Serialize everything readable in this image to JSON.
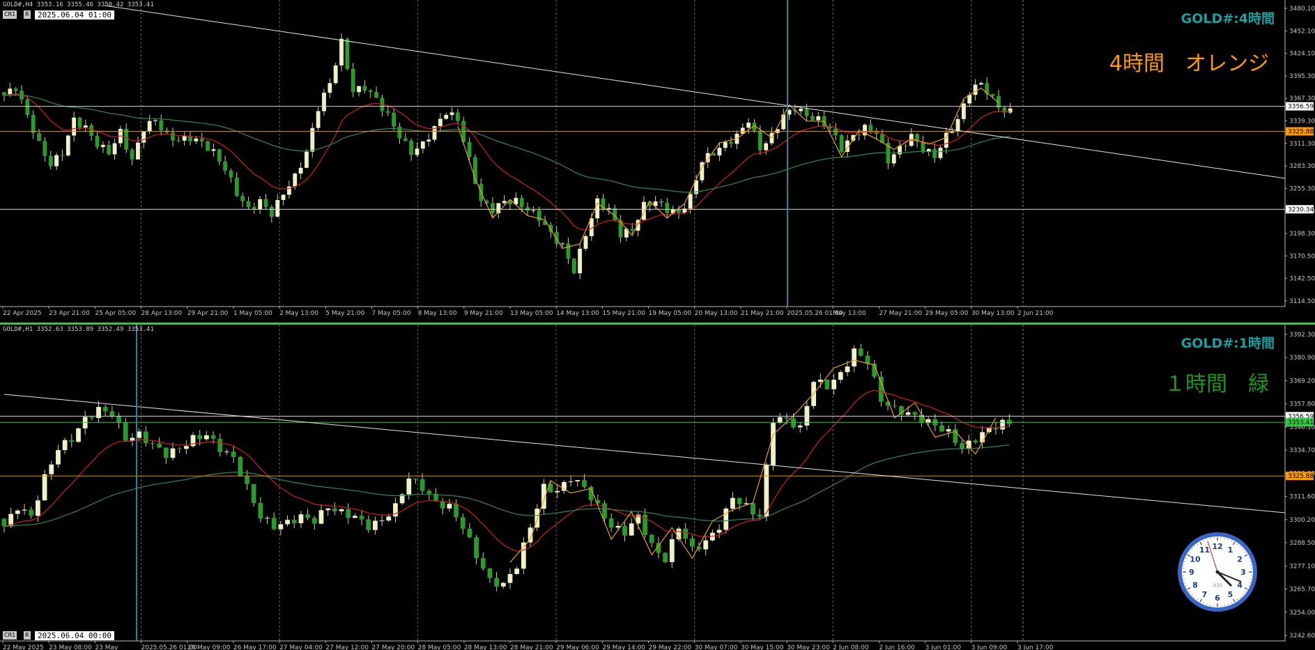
{
  "top": {
    "header": "GOLD#,H4  3353.16 3355.46 3350.42 3353.41",
    "cr_label": "CR1",
    "r_label": "R",
    "date_box": "2025.06.04 01:00",
    "title": "GOLD#:4時間",
    "subtitle": "4時間　オレンジ",
    "subtitle_color": "#ff9900",
    "x_labels": [
      "22 Apr 2025",
      "23 Apr 21:00",
      "25 Apr 05:00",
      "28 Apr 13:00",
      "29 Apr 21:00",
      "1 May 05:00",
      "2 May 13:00",
      "5 May 21:00",
      "7 May 05:00",
      "8 May 13:00",
      "9 May 21:00",
      "13 May 05:00",
      "14 May 13:00",
      "15 May 21:00",
      "19 May 05:00",
      "20 May 13:00",
      "21 May 21:00",
      "2025.05.26 01:00",
      "May 13:00",
      "27 May 21:00",
      "29 May 05:00",
      "30 May 13:00",
      "2 Jun 21:00"
    ],
    "y_labels": [
      "3480.10",
      "3452.10",
      "3424.10",
      "3395.30",
      "3367.30",
      "3339.30",
      "3311.30",
      "3283.30",
      "3255.30",
      "3226.30",
      "3198.30",
      "3170.50",
      "3142.50",
      "3114.50"
    ],
    "price_tags": [
      "3356.59",
      "3325.88",
      "3230.34"
    ]
  },
  "bottom": {
    "header": "GOLD#,H1  3352.63 3353.89 3352.49 3353.41",
    "cr_label": "CR1",
    "r_label": "R",
    "date_box": "2025.06.04 00:00",
    "title": "GOLD#:1時間",
    "subtitle": "１時間　緑",
    "subtitle_color": "#1a9a1a",
    "x_labels": [
      "22 May 2025",
      "23 May 08:00",
      "23 May",
      "2025.05.26 01:00",
      "26 May 09:00",
      "26 May 17:00",
      "27 May 04:00",
      "27 May 12:00",
      "27 May 20:00",
      "28 May 05:00",
      "28 May 13:00",
      "28 May 21:00",
      "29 May 06:00",
      "29 May 14:00",
      "29 May 22:00",
      "30 May 07:00",
      "30 May 15:00",
      "30 May 23:00",
      "2 Jun 08:00",
      "2 Jun 16:00",
      "3 Jun 01:00",
      "3 Jun 09:00",
      "3 Jun 17:00"
    ],
    "y_labels": [
      "3392.30",
      "3380.90",
      "3369.20",
      "3357.80",
      "3346.10",
      "3334.70",
      "3323.30",
      "3311.60",
      "3300.20",
      "3288.50",
      "3277.10",
      "3265.70",
      "3254.00",
      "3242.60"
    ],
    "price_tags": [
      "3356.59",
      "3353.41",
      "3325.88"
    ]
  },
  "clock": {
    "numbers": [
      "12",
      "1",
      "2",
      "3",
      "4",
      "5",
      "6",
      "7",
      "8",
      "9",
      "10",
      "11"
    ],
    "am_label": "AM"
  },
  "chart_data": [
    {
      "type": "candlestick",
      "title": "GOLD#:4時間",
      "timeframe": "H4",
      "ylim": [
        3114.5,
        3480.1
      ],
      "horizontal_levels": [
        3356.59,
        3325.88,
        3230.34
      ],
      "ohlc_last": {
        "open": 3353.16,
        "high": 3355.46,
        "low": 3350.42,
        "close": 3353.41
      },
      "close_path": [
        3370,
        3380,
        3345,
        3310,
        3285,
        3300,
        3340,
        3330,
        3310,
        3300,
        3325,
        3290,
        3330,
        3340,
        3320,
        3315,
        3318,
        3312,
        3300,
        3280,
        3250,
        3230,
        3240,
        3225,
        3250,
        3270,
        3300,
        3355,
        3385,
        3435,
        3375,
        3380,
        3365,
        3345,
        3320,
        3300,
        3310,
        3330,
        3350,
        3340,
        3290,
        3240,
        3230,
        3240,
        3240,
        3230,
        3220,
        3200,
        3185,
        3155,
        3200,
        3240,
        3230,
        3200,
        3205,
        3235,
        3240,
        3230,
        3225,
        3245,
        3290,
        3300,
        3310,
        3320,
        3340,
        3305,
        3320,
        3345,
        3355,
        3345,
        3340,
        3330,
        3305,
        3320,
        3330,
        3325,
        3290,
        3305,
        3320,
        3305,
        3295,
        3320,
        3340,
        3375,
        3385,
        3365,
        3350
      ]
    },
    {
      "type": "candlestick",
      "title": "GOLD#:1時間",
      "timeframe": "H1",
      "ylim": [
        3242.6,
        3400
      ],
      "horizontal_levels": [
        3356.59,
        3353.41,
        3325.88
      ],
      "ohlc_last": {
        "open": 3352.63,
        "high": 3353.89,
        "low": 3352.49,
        "close": 3353.41
      },
      "close_path": [
        3300,
        3310,
        3305,
        3325,
        3340,
        3345,
        3355,
        3360,
        3358,
        3345,
        3347,
        3342,
        3337,
        3340,
        3345,
        3347,
        3340,
        3335,
        3320,
        3305,
        3300,
        3302,
        3305,
        3303,
        3310,
        3307,
        3305,
        3300,
        3303,
        3310,
        3325,
        3320,
        3312,
        3310,
        3300,
        3285,
        3272,
        3270,
        3280,
        3300,
        3320,
        3318,
        3325,
        3320,
        3310,
        3300,
        3297,
        3305,
        3290,
        3283,
        3300,
        3288,
        3292,
        3300,
        3315,
        3310,
        3305,
        3355,
        3355,
        3350,
        3375,
        3372,
        3378,
        3390,
        3385,
        3365,
        3360,
        3358,
        3355,
        3352,
        3348,
        3340,
        3345,
        3350,
        3353
      ]
    }
  ]
}
